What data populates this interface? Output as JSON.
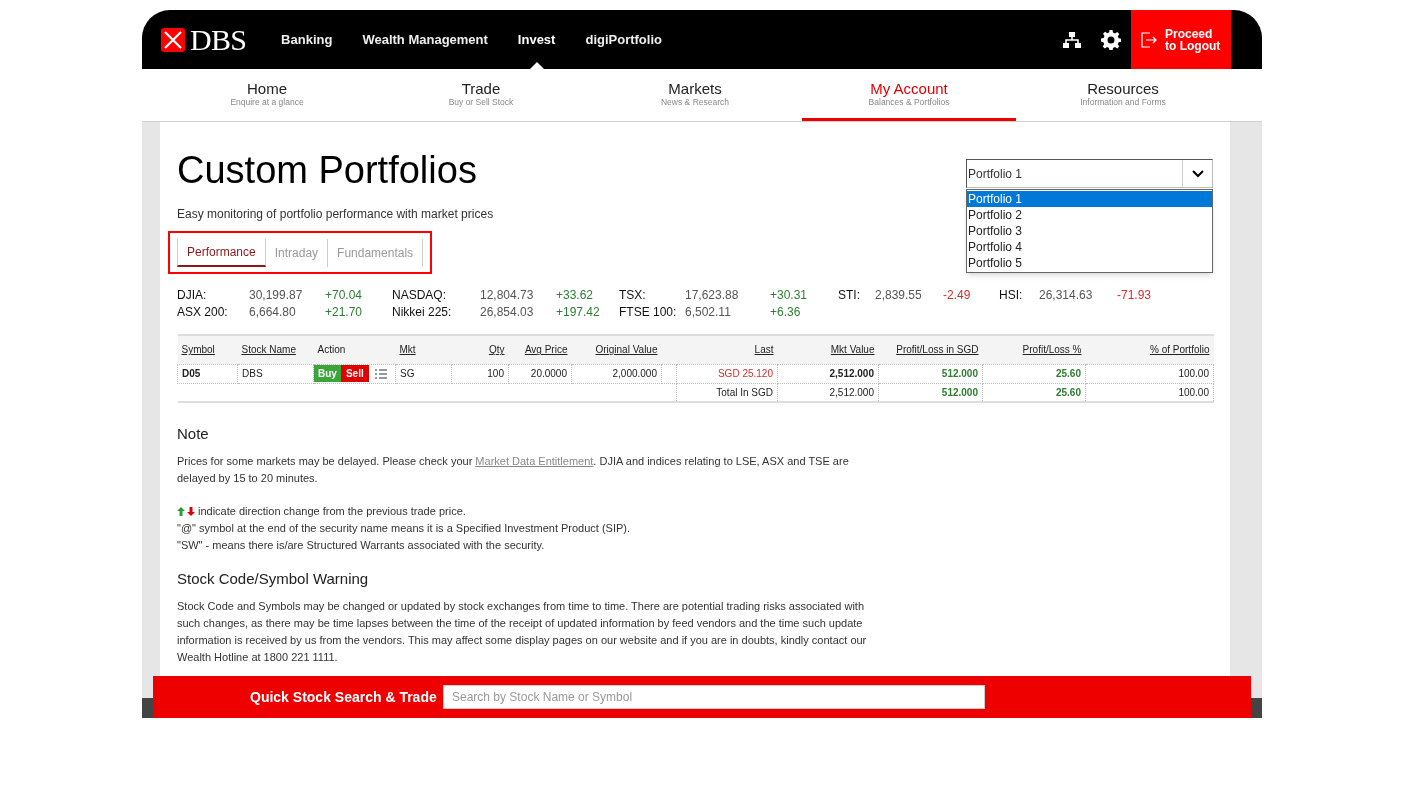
{
  "header": {
    "logo": "DBS",
    "menu": [
      {
        "label": "Banking",
        "selected": false
      },
      {
        "label": "Wealth Management",
        "selected": false
      },
      {
        "label": "Invest",
        "selected": true
      },
      {
        "label": "digiPortfolio",
        "selected": false
      }
    ],
    "logout": "Proceed to Logout"
  },
  "nav": [
    {
      "label": "Home",
      "subtitle": "Enquire at a glance",
      "selected": false
    },
    {
      "label": "Trade",
      "subtitle": "Buy or Sell Stock",
      "selected": false
    },
    {
      "label": "Markets",
      "subtitle": "News & Research",
      "selected": false
    },
    {
      "label": "My Account",
      "subtitle": "Balances & Portfolios",
      "selected": true
    },
    {
      "label": "Resources",
      "subtitle": "Information and Forms",
      "selected": false
    }
  ],
  "page": {
    "title": "Custom Portfolios",
    "subtitle": "Easy monitoring of portfolio performance with market prices"
  },
  "portfolio_select": {
    "value": "Portfolio 1",
    "expanded": true,
    "options": [
      {
        "label": "Portfolio 1",
        "selected": true
      },
      {
        "label": "Portfolio 2",
        "selected": false
      },
      {
        "label": "Portfolio 3",
        "selected": false
      },
      {
        "label": "Portfolio 4",
        "selected": false
      },
      {
        "label": "Portfolio 5",
        "selected": false
      }
    ]
  },
  "tabs": [
    {
      "label": "Performance",
      "selected": true
    },
    {
      "label": "Intraday",
      "selected": false
    },
    {
      "label": "Fundamentals",
      "selected": false
    }
  ],
  "indices": [
    [
      {
        "name": "DJIA:",
        "value": "30,199.87",
        "change": "+70.04",
        "down": false
      },
      {
        "name": "NASDAQ:",
        "value": "12,804.73",
        "change": "+33.62",
        "down": false
      },
      {
        "name": "TSX:",
        "value": "17,623.88",
        "change": "+30.31",
        "down": false
      },
      {
        "name": "STI:",
        "value": "2,839.55",
        "change": "-2.49",
        "down": true
      },
      {
        "name": "HSI:",
        "value": "26,314.63",
        "change": "-71.93",
        "down": true
      }
    ],
    [
      {
        "name": "ASX 200:",
        "value": "6,664.80",
        "change": "+21.70",
        "down": false
      },
      {
        "name": "Nikkei 225:",
        "value": "26,854.03",
        "change": "+197.42",
        "down": false
      },
      {
        "name": "FTSE 100:",
        "value": "6,502.11",
        "change": "+6.36",
        "down": false
      }
    ]
  ],
  "table": {
    "columns": [
      {
        "label": "Symbol",
        "sortable": true
      },
      {
        "label": "Stock Name",
        "sortable": true
      },
      {
        "label": "Action",
        "sortable": false
      },
      {
        "label": "Mkt",
        "sortable": true
      },
      {
        "label": "Qty",
        "sortable": true
      },
      {
        "label": "Avg Price",
        "sortable": true
      },
      {
        "label": "Original Value",
        "sortable": true
      },
      {
        "label": "Last",
        "sortable": true
      },
      {
        "label": "Mkt Value",
        "sortable": true
      },
      {
        "label": "Profit/Loss in SGD",
        "sortable": true
      },
      {
        "label": "Profit/Loss %",
        "sortable": true
      },
      {
        "label": "% of Portfolio",
        "sortable": true
      }
    ],
    "rows": [
      {
        "kind": "holding",
        "symbol": "D05",
        "stock_name": "DBS",
        "buy": "Buy",
        "sell": "Sell",
        "mkt": "SG",
        "qty": "100",
        "avg_price": "20.0000",
        "original_value": "2,000.000",
        "last": "SGD 25.120",
        "last_down": true,
        "mkt_value": "2,512.000",
        "pl_sgd": "512.000",
        "pl_pct": "25.60",
        "pl_down": false,
        "pct_portfolio": "100.00"
      },
      {
        "kind": "total",
        "label": "Total In SGD",
        "mkt_value": "2,512.000",
        "pl_sgd": "512.000",
        "pl_pct": "25.60",
        "pl_down": false,
        "pct_portfolio": "100.00"
      }
    ]
  },
  "note": {
    "title": "Note",
    "delay_before": "Prices for some markets may be delayed. Please check your ",
    "delay_link": "Market Data Entitlement",
    "delay_after": ". DJIA and indices relating to LSE, ASX and TSE are delayed by 15 to 20 minutes.",
    "arrows_text": "indicate direction change from the previous trade price.",
    "lines": [
      "\"@\" symbol at the end of the security name means it is a Specified Investment Product (SIP).",
      "\"SW\" - means there is/are Structured Warrants associated with the security."
    ]
  },
  "warning": {
    "title": "Stock Code/Symbol Warning",
    "text": "Stock Code and Symbols may be changed or updated by stock exchanges from time to time. There are potential trading risks associated with such changes, as there may be time lapses between the time of the receipt of updated information by feed vendors and the time such update information is received by us from the vendors. This may affect some display pages on our website and if you are in doubts, kindly contact our Wealth Hotline at 1800 221 1111."
  },
  "quick_search": {
    "title": "Quick Stock Search & Trade",
    "placeholder": "Search by Stock Name or Symbol"
  }
}
